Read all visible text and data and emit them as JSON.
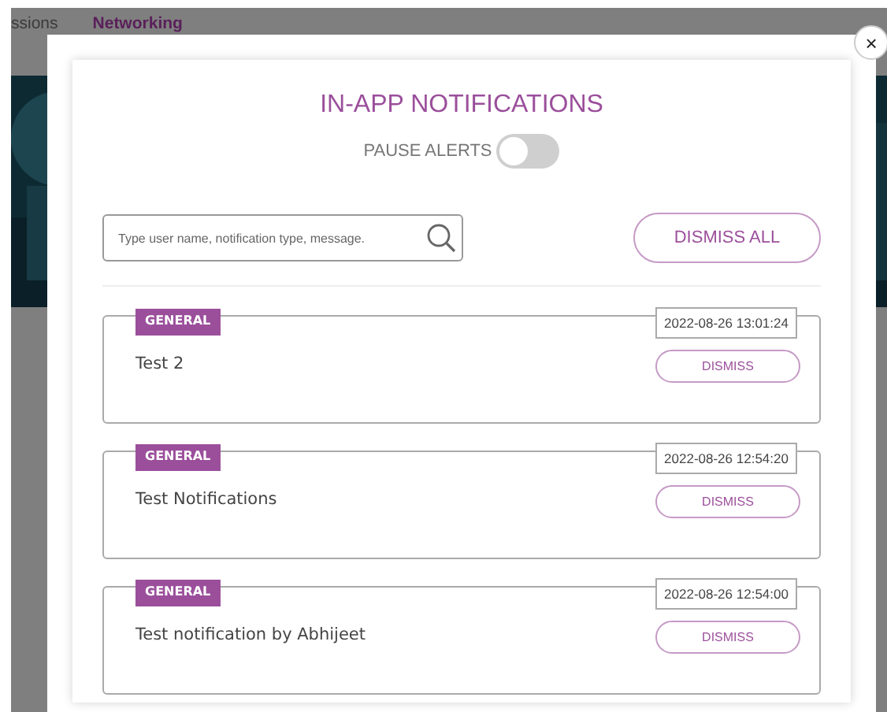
{
  "background": {
    "tabs": [
      {
        "label": "ssions",
        "selected": false
      },
      {
        "label": "Networking",
        "selected": true
      }
    ]
  },
  "dialog": {
    "title": "IN-APP NOTIFICATIONS",
    "pause_alerts": {
      "label": "PAUSE ALERTS",
      "on": false
    },
    "search": {
      "placeholder": "Type user name, notification type, message."
    },
    "dismiss_all": "DISMISS ALL",
    "close": "×",
    "notifications": [
      {
        "category": "GENERAL",
        "message": "Test 2",
        "time": "2022-08-26 13:01:24",
        "action": "DISMISS"
      },
      {
        "category": "GENERAL",
        "message": "Test Notifications",
        "time": "2022-08-26 12:54:20",
        "action": "DISMISS"
      },
      {
        "category": "GENERAL",
        "message": "Test notification by Abhijeet",
        "time": "2022-08-26 12:54:00",
        "action": "DISMISS"
      }
    ]
  }
}
